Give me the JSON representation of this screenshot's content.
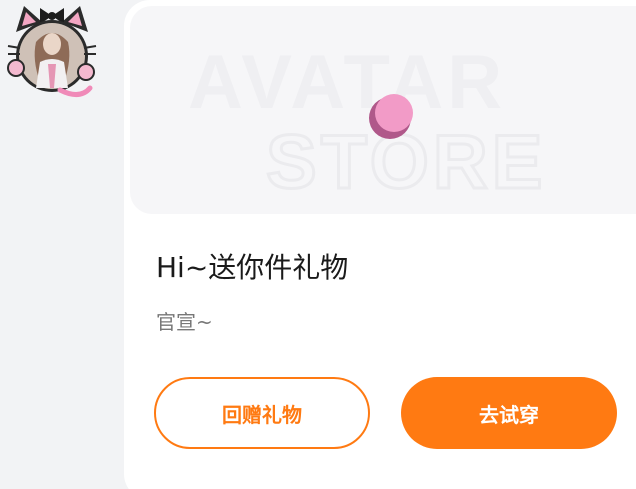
{
  "avatar": {
    "icon": "cat-ear-avatar-frame"
  },
  "gift_card": {
    "banner": {
      "line1": "AVATAR",
      "line2": "STORE",
      "loading_color": "#f08ab8"
    },
    "title": "Hi~送你件礼物",
    "subtitle": "官宣~",
    "buttons": {
      "gift_back": "回赠礼物",
      "try_on": "去试穿"
    },
    "accent_color": "#ff7a12"
  }
}
